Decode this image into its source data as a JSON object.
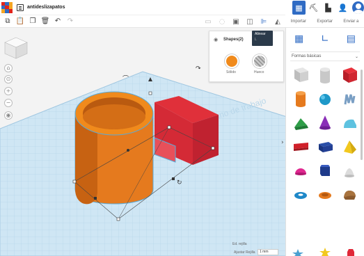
{
  "app": {
    "document_title": "antideslizapatos",
    "logo_colors": [
      "#e2231a",
      "#2f6bc4",
      "#f5a623",
      "#2f6bc4",
      "#e2231a",
      "#f5a623",
      "#f5a623",
      "#2f6bc4",
      "#e2231a"
    ]
  },
  "header_actions": {
    "import_label": "Importar",
    "export_label": "Exportar",
    "send_label": "Enviar a"
  },
  "shapes_popup": {
    "title": "Shapes(2)",
    "solid_label": "Sólido",
    "hole_label": "Hueco",
    "solid_color": "#f08a1c"
  },
  "tooltip": {
    "text": "Alinear",
    "shortcut": "L"
  },
  "workplane": {
    "label": "Plano de trabajo",
    "edit_grid_label": "Ed. rejilla",
    "snap_label": "Ajustar Rejilla",
    "snap_value": "1 mm"
  },
  "library": {
    "category": "Formas básicas",
    "shapes": [
      {
        "name": "box-hole"
      },
      {
        "name": "cylinder-hole"
      },
      {
        "name": "box"
      },
      {
        "name": "cylinder"
      },
      {
        "name": "sphere"
      },
      {
        "name": "scribble"
      },
      {
        "name": "roof"
      },
      {
        "name": "cone"
      },
      {
        "name": "round-roof"
      },
      {
        "name": "text"
      },
      {
        "name": "prism"
      },
      {
        "name": "pyramid"
      },
      {
        "name": "half-sphere"
      },
      {
        "name": "polygon"
      },
      {
        "name": "paraboloid"
      },
      {
        "name": "torus"
      },
      {
        "name": "tube"
      },
      {
        "name": "shape-generator"
      }
    ]
  },
  "colors": {
    "accent": "#2f6bc4",
    "orange": "#f08a1c",
    "red": "#e0303a",
    "grid_blue": "#cfe6f4"
  }
}
